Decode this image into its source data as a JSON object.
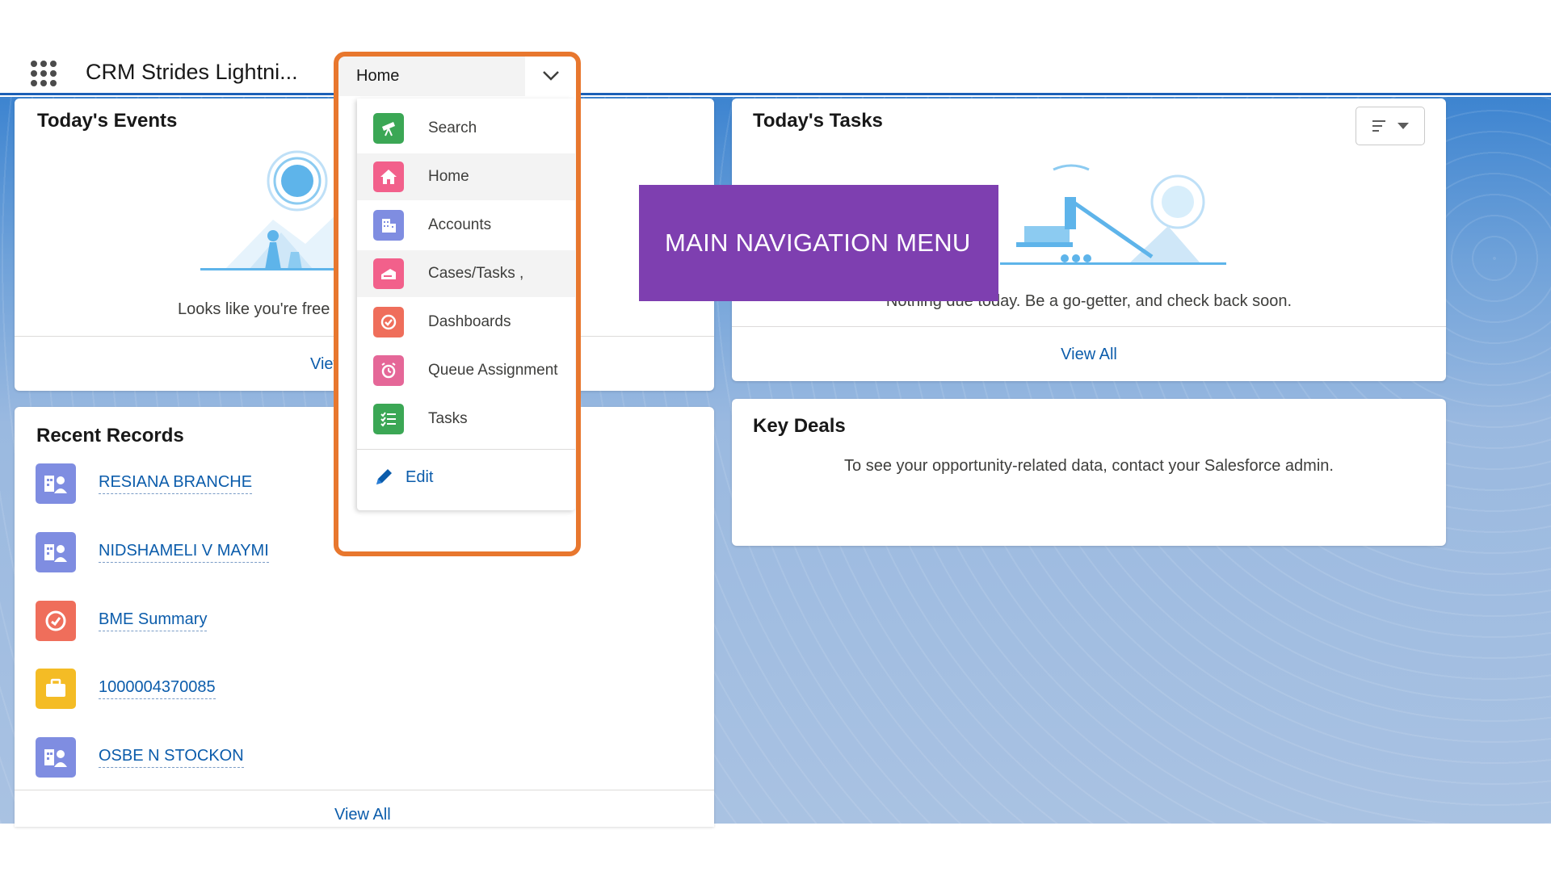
{
  "header": {
    "app_name": "CRM Strides Lightni...",
    "nav_selected": "Home"
  },
  "nav_menu": {
    "items": [
      {
        "label": "Search",
        "icon": "telescope-icon",
        "color": "#3ba755"
      },
      {
        "label": "Home",
        "icon": "home-icon",
        "color": "#f2608b"
      },
      {
        "label": "Accounts",
        "icon": "account-building-icon",
        "color": "#7f8de1"
      },
      {
        "label": "Cases/Tasks ,",
        "icon": "case-icon",
        "color": "#f2608b"
      },
      {
        "label": "Dashboards",
        "icon": "dashboard-gauge-icon",
        "color": "#ef6e5b"
      },
      {
        "label": "Queue Assignment",
        "icon": "alarm-clock-icon",
        "color": "#e56798"
      },
      {
        "label": "Tasks",
        "icon": "task-list-icon",
        "color": "#3ba755"
      }
    ],
    "edit_label": "Edit"
  },
  "callout": {
    "text": "MAIN NAVIGATION MENU",
    "color": "#7e3fb0"
  },
  "events": {
    "title": "Today's Events",
    "message": "Looks like you're free an",
    "view_all": "View C"
  },
  "tasks": {
    "title": "Today's Tasks",
    "message": "Nothing due today. Be a go-getter, and check back soon.",
    "view_all": "View All"
  },
  "recent": {
    "title": "Recent Records",
    "items": [
      {
        "label": "RESIANA BRANCHE",
        "icon": "contact-building-icon",
        "color": "#7f8de1"
      },
      {
        "label": "NIDSHAMELI V MAYMI",
        "icon": "contact-building-icon",
        "color": "#7f8de1"
      },
      {
        "label": "BME Summary",
        "icon": "dashboard-gauge-icon",
        "color": "#ef6e5b"
      },
      {
        "label": "1000004370085",
        "icon": "briefcase-icon",
        "color": "#f4bc25"
      },
      {
        "label": "OSBE N STOCKON",
        "icon": "contact-building-icon",
        "color": "#7f8de1"
      }
    ],
    "view_all": "View All"
  },
  "deals": {
    "title": "Key Deals",
    "message": "To see your opportunity-related data, contact your Salesforce admin."
  },
  "colors": {
    "accent_blue": "#1b5fb6",
    "link_blue": "#0b5cab",
    "highlight_orange": "#e8772e"
  }
}
